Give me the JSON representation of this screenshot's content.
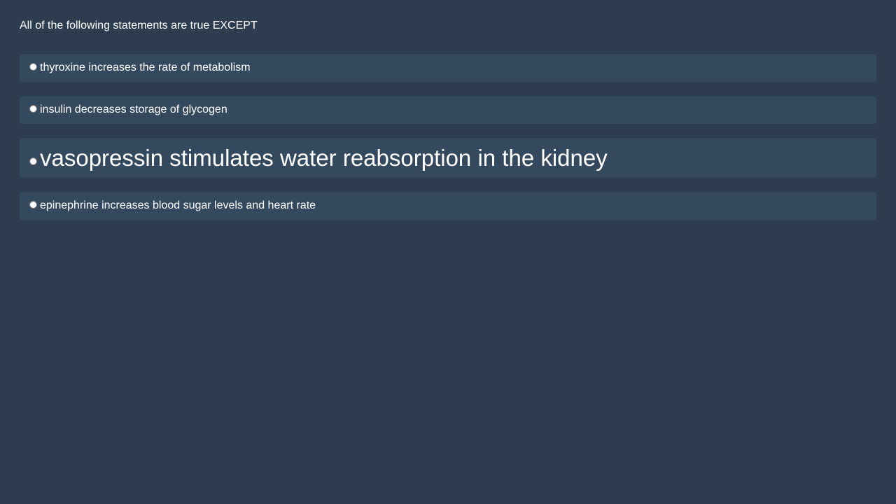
{
  "question": "All of the following statements are true EXCEPT",
  "options": [
    {
      "label": "thyroxine increases the rate of metabolism"
    },
    {
      "label": "insulin decreases storage of glycogen"
    },
    {
      "label": "vasopressin stimulates water reabsorption in the kidney"
    },
    {
      "label": "epinephrine increases blood sugar levels and heart rate"
    }
  ],
  "colors": {
    "background": "#2d3d4f",
    "option_background": "#34495e",
    "text": "#ffffff"
  }
}
